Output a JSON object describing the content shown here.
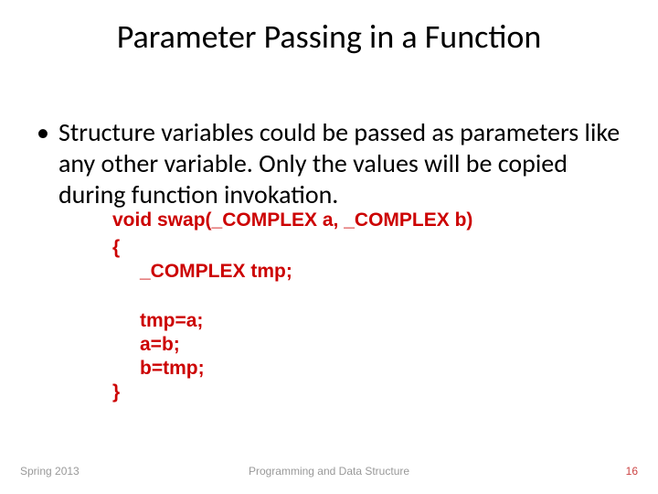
{
  "title": "Parameter Passing in a Function",
  "bullet": "•",
  "body": "Structure variables could be passed as parameters like any other variable. Only the values will be copied during function invokation.",
  "code": {
    "sig": "void swap(_COMPLEX a, _COMPLEX b)",
    "brace_open": "{",
    "decl": "_COMPLEX tmp;",
    "l1": "tmp=a;",
    "l2": "a=b;",
    "l3": "b=tmp;",
    "brace_close": "}"
  },
  "footer": {
    "left": "Spring 2013",
    "center": "Programming and Data Structure",
    "right": "16"
  }
}
